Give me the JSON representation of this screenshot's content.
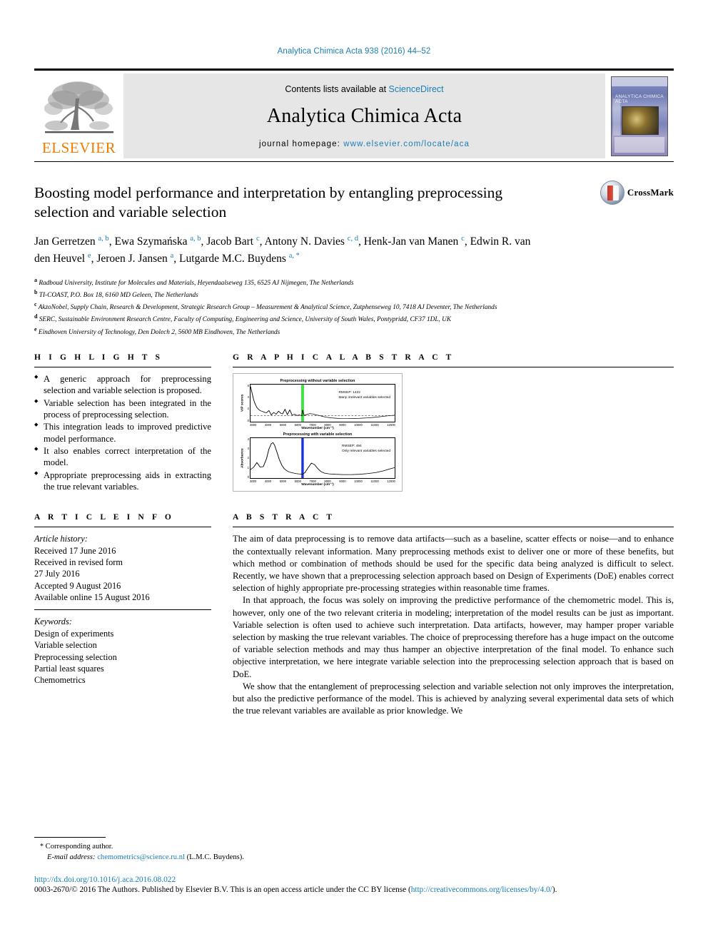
{
  "running_head": "Analytica Chimica Acta 938 (2016) 44–52",
  "masthead": {
    "publisher_logo_text": "ELSEVIER",
    "contents_prefix": "Contents lists available at ",
    "contents_link": "ScienceDirect",
    "journal_name": "Analytica Chimica Acta",
    "homepage_prefix": "journal homepage: ",
    "homepage_url": "www.elsevier.com/locate/aca",
    "cover_title": "ANALYTICA CHIMICA ACTA"
  },
  "article": {
    "title": "Boosting model performance and interpretation by entangling preprocessing selection and variable selection",
    "crossmark_label": "CrossMark",
    "authors_html": "Jan Gerretzen <sup>a, b</sup>, Ewa Szymańska <sup>a, b</sup>, Jacob Bart <sup>c</sup>, Antony N. Davies <sup>c, d</sup>, Henk-Jan van Manen <sup>c</sup>, Edwin R. van den Heuvel <sup>e</sup>, Jeroen J. Jansen <sup>a</sup>, Lutgarde M.C. Buydens <sup>a, *</sup>",
    "affiliations": [
      {
        "marker": "a",
        "text": "Radboud University, Institute for Molecules and Materials, Heyendaalseweg 135, 6525 AJ Nijmegen, The Netherlands"
      },
      {
        "marker": "b",
        "text": "TI-COAST, P.O. Box 18, 6160 MD Geleen, The Netherlands"
      },
      {
        "marker": "c",
        "text": "AkzoNobel, Supply Chain, Research & Development, Strategic Research Group – Measurement & Analytical Science, Zutphenseweg 10, 7418 AJ Deventer, The Netherlands"
      },
      {
        "marker": "d",
        "text": "SERC, Sustainable Environment Research Centre, Faculty of Computing, Engineering and Science, University of South Wales, Pontypridd, CF37 1DL, UK"
      },
      {
        "marker": "e",
        "text": "Eindhoven University of Technology, Den Dolech 2, 5600 MB Eindhoven, The Netherlands"
      }
    ]
  },
  "highlights": {
    "heading": "H I G H L I G H T S",
    "items": [
      "A generic approach for preprocessing selection and variable selection is proposed.",
      "Variable selection has been integrated in the process of preprocessing selection.",
      "This integration leads to improved predictive model performance.",
      "It also enables correct interpretation of the model.",
      "Appropriate preprocessing aids in extracting the true relevant variables."
    ]
  },
  "article_info": {
    "heading": "A R T I C L E   I N F O",
    "history_label": "Article history:",
    "history": [
      "Received 17 June 2016",
      "Received in revised form",
      "27 July 2016",
      "Accepted 9 August 2016",
      "Available online 15 August 2016"
    ],
    "keywords_label": "Keywords:",
    "keywords": [
      "Design of experiments",
      "Variable selection",
      "Preprocessing selection",
      "Partial least squares",
      "Chemometrics"
    ]
  },
  "graphical_abstract": {
    "heading": "G R A P H I C A L   A B S T R A C T"
  },
  "chart_data": [
    {
      "type": "line",
      "title": "Preprocessing without variable selection",
      "xlabel": "Wavenumber (cm⁻¹)",
      "ylabel": "VIP scores",
      "xlim": [
        3000,
        12000
      ],
      "ylim": [
        0,
        6
      ],
      "xticks": [
        "3000",
        "4000",
        "5000",
        "6000",
        "7000",
        "8000",
        "9000",
        "10000",
        "11000",
        "12000"
      ],
      "yticks": [
        "6",
        "4",
        "2",
        "0"
      ],
      "grid": false,
      "annotations": [
        "RMSEP: 1422",
        "Many irrelevant variables selected"
      ],
      "threshold_line": 1.0,
      "highlight_band": {
        "color": "#44e04a",
        "center": 6250,
        "width": 180
      },
      "x": [
        3000,
        3100,
        3200,
        3300,
        3400,
        3500,
        3600,
        3700,
        3800,
        3900,
        4000,
        4150,
        4300,
        4450,
        4600,
        4750,
        4900,
        5000,
        5150,
        5300,
        5450,
        5600,
        5750,
        5900,
        6050,
        6200,
        6250,
        6350,
        6500,
        6700,
        6900,
        7100,
        7300,
        7500,
        7800,
        8100,
        8400,
        8700,
        9000,
        9400,
        9800,
        10200,
        10600,
        11000,
        11400,
        11800,
        12000
      ],
      "y": [
        5.7,
        4.6,
        3.5,
        2.8,
        2.3,
        2.0,
        1.8,
        1.7,
        1.6,
        1.5,
        1.45,
        1.8,
        1.1,
        1.5,
        1.2,
        1.7,
        1.35,
        1.25,
        2.0,
        1.15,
        1.9,
        1.05,
        1.2,
        1.0,
        1.1,
        0.95,
        1.9,
        1.0,
        1.15,
        1.3,
        1.25,
        1.1,
        1.0,
        0.85,
        0.7,
        0.6,
        0.55,
        0.5,
        0.5,
        0.52,
        0.55,
        0.6,
        0.68,
        0.78,
        0.9,
        1.0,
        1.05
      ]
    },
    {
      "type": "line",
      "title": "Preprocessing with variable selection",
      "xlabel": "Wavenumber (cm⁻¹)",
      "ylabel": "Absorbance",
      "xlim": [
        3000,
        12000
      ],
      "ylim": [
        0,
        4
      ],
      "xticks": [
        "3000",
        "4000",
        "5000",
        "6000",
        "7000",
        "8000",
        "9000",
        "10000",
        "11000",
        "12000"
      ],
      "yticks": [
        "4",
        "3",
        "2",
        "1",
        "0"
      ],
      "grid": false,
      "annotations": [
        "RMSEP: 494",
        "Only relevant variables selected"
      ],
      "highlight_band": {
        "color": "#1535d6",
        "center": 6250,
        "width": 150
      },
      "x": [
        3000,
        3200,
        3400,
        3600,
        3800,
        4000,
        4150,
        4300,
        4400,
        4500,
        4650,
        4800,
        4950,
        5100,
        5250,
        5400,
        5550,
        5700,
        5850,
        6000,
        6150,
        6250,
        6400,
        6600,
        6800,
        7000,
        7200,
        7400,
        7600,
        7900,
        8300,
        8800,
        9300,
        9800,
        10300,
        10800,
        11300,
        11700,
        12000
      ],
      "y": [
        0.85,
        1.1,
        1.55,
        1.1,
        1.15,
        1.95,
        2.9,
        3.45,
        3.55,
        3.3,
        2.6,
        1.85,
        1.3,
        0.95,
        0.75,
        0.62,
        0.55,
        0.5,
        0.45,
        0.42,
        0.4,
        0.38,
        0.55,
        1.05,
        1.5,
        1.35,
        0.95,
        0.65,
        0.5,
        0.42,
        0.38,
        0.35,
        0.35,
        0.38,
        0.45,
        0.55,
        0.72,
        0.92,
        1.05
      ]
    }
  ],
  "abstract": {
    "heading": "A B S T R A C T",
    "paragraphs": [
      "The aim of data preprocessing is to remove data artifacts—such as a baseline, scatter effects or noise—and to enhance the contextually relevant information. Many preprocessing methods exist to deliver one or more of these benefits, but which method or combination of methods should be used for the specific data being analyzed is difficult to select. Recently, we have shown that a preprocessing selection approach based on Design of Experiments (DoE) enables correct selection of highly appropriate pre-processing strategies within reasonable time frames.",
      "In that approach, the focus was solely on improving the predictive performance of the chemometric model. This is, however, only one of the two relevant criteria in modeling; interpretation of the model results can be just as important. Variable selection is often used to achieve such interpretation. Data artifacts, however, may hamper proper variable selection by masking the true relevant variables. The choice of preprocessing therefore has a huge impact on the outcome of variable selection methods and may thus hamper an objective interpretation of the final model. To enhance such objective interpretation, we here integrate variable selection into the preprocessing selection approach that is based on DoE.",
      "We show that the entanglement of preprocessing selection and variable selection not only improves the interpretation, but also the predictive performance of the model. This is achieved by analyzing several experimental data sets of which the true relevant variables are available as prior knowledge. We"
    ]
  },
  "footer": {
    "corresponding_label": "Corresponding author.",
    "email_label": "E-mail address:",
    "email": "chemometrics@science.ru.nl",
    "email_suffix": "(L.M.C. Buydens).",
    "doi": "http://dx.doi.org/10.1016/j.aca.2016.08.022",
    "copyright_prefix": "0003-2670/© 2016 The Authors. Published by Elsevier B.V. This is an open access article under the CC BY license (",
    "license_url": "http://creativecommons.org/licenses/by/4.0/",
    "copyright_suffix": ")."
  }
}
